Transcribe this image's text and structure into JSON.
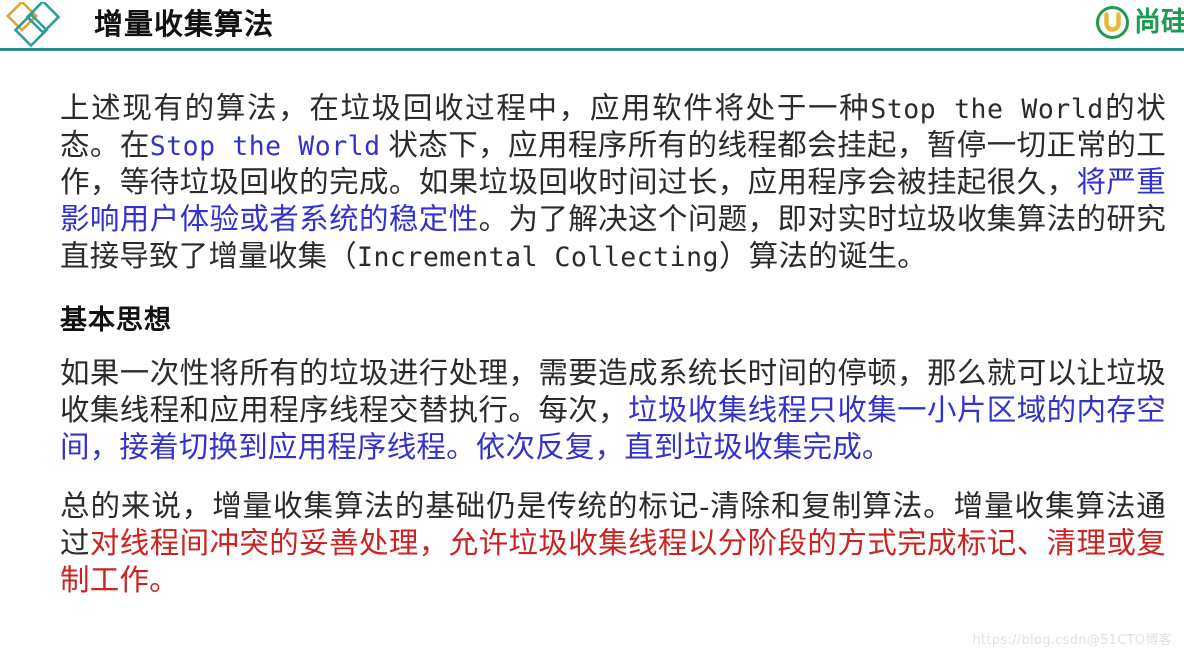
{
  "header": {
    "title": "增量收集算法",
    "logo_icon": "diamond-cluster-logo",
    "brand_icon": "circle-u-icon",
    "brand_text": "尚硅",
    "colors": {
      "rule": "#2e8b84",
      "logo_orange": "#e3a33a",
      "logo_teal": "#2e9e95",
      "brand_green": "#1f9a52"
    }
  },
  "content": {
    "paragraph1": {
      "seg1": "上述现有的算法，在垃圾回收过程中，应用软件将处于一种",
      "seg2_mono_dark": "Stop the World",
      "seg3": "的状态。在",
      "seg4_mono_blue": "Stop the World",
      "seg5": " 状态下，应用程序所有的线程都会挂起，暂停一切正常的工作，等待垃圾回收的完成。如果垃圾回收时间过长，应用程序会被挂起很久，",
      "seg6_blue": "将严重影响用户体验或者系统的稳定性",
      "seg7": "。为了解决这个问题，即对实时垃圾收集算法的研究直接导致了增量收集（",
      "seg8_mono_dark": "Incremental Collecting",
      "seg9": "）算法的诞生。"
    },
    "heading1": "基本思想",
    "paragraph2": {
      "seg1": "如果一次性将所有的垃圾进行处理，需要造成系统长时间的停顿，那么就可以让垃圾收集线程和应用程序线程交替执行。每次，",
      "seg2_blue": "垃圾收集线程只收集一小片区域的内存空间，接着切换到应用程序线程。依次反复，直到垃圾收集完成。"
    },
    "paragraph3": {
      "seg1": "总的来说，增量收集算法的基础仍是传统的标记-清除和复制算法。增量收集算法通过",
      "seg2_red": "对线程间冲突的妥善处理，允许垃圾收集线程以分阶段的方式完成标记、清理或复制工作。"
    }
  },
  "watermark": "https://blog.csdn@51CTO博客"
}
